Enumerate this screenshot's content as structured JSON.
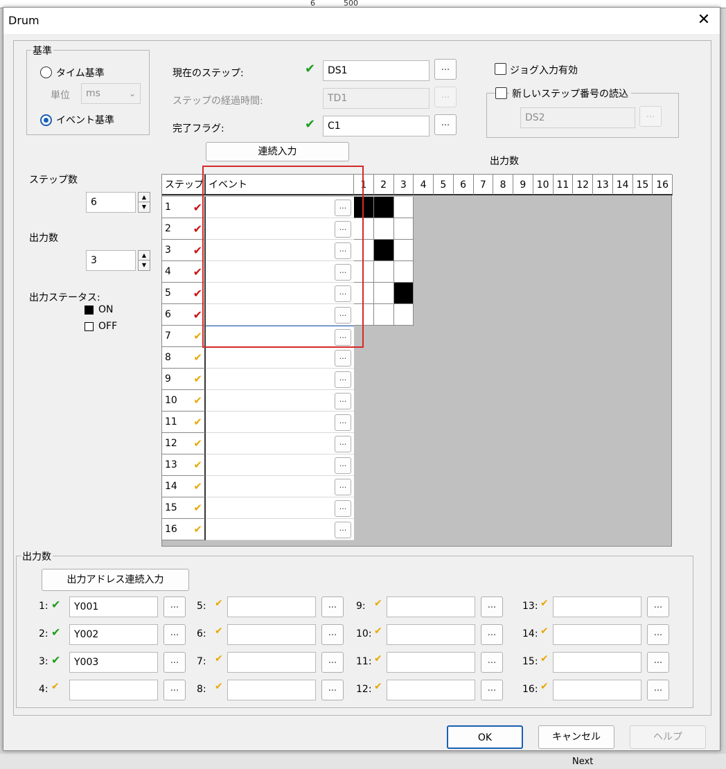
{
  "background": {
    "top_text_1": "6",
    "top_text_2": "500",
    "bottom_text": "Next"
  },
  "window": {
    "title": "Drum",
    "close_label": "✕"
  },
  "basis_group": {
    "legend": "基準",
    "time_basis_label": "タイム基準",
    "unit_label": "単位",
    "unit_value": "ms",
    "event_basis_label": "イベント基準",
    "selected": "event"
  },
  "steps_config": {
    "current_step_label": "現在のステップ:",
    "current_step_value": "DS1",
    "elapsed_label": "ステップの経過時間:",
    "elapsed_value": "TD1",
    "done_flag_label": "完了フラグ:",
    "done_flag_value": "C1",
    "dots": "..."
  },
  "jog": {
    "jog_label": "ジョグ入力有効",
    "new_step_label": "新しいステップ番号の読込",
    "new_step_value": "DS2"
  },
  "continuous_input_label": "連続入力",
  "left_panel": {
    "step_count_label": "ステップ数",
    "step_count_value": "6",
    "output_count_label": "出力数",
    "output_count_value": "3",
    "output_status_label": "出力ステータス:",
    "on_label": "ON",
    "off_label": "OFF"
  },
  "table": {
    "step_header": "ステップ",
    "event_header": "イベント",
    "outputs_header": "出力数",
    "output_numbers": [
      "1",
      "2",
      "3",
      "4",
      "5",
      "6",
      "7",
      "8",
      "9",
      "10",
      "11",
      "12",
      "13",
      "14",
      "15",
      "16"
    ],
    "steps": [
      {
        "num": "1",
        "status": "set"
      },
      {
        "num": "2",
        "status": "set"
      },
      {
        "num": "3",
        "status": "set"
      },
      {
        "num": "4",
        "status": "set"
      },
      {
        "num": "5",
        "status": "set"
      },
      {
        "num": "6",
        "status": "set"
      },
      {
        "num": "7",
        "status": "unset"
      },
      {
        "num": "8",
        "status": "unset"
      },
      {
        "num": "9",
        "status": "unset"
      },
      {
        "num": "10",
        "status": "unset"
      },
      {
        "num": "11",
        "status": "unset"
      },
      {
        "num": "12",
        "status": "unset"
      },
      {
        "num": "13",
        "status": "unset"
      },
      {
        "num": "14",
        "status": "unset"
      },
      {
        "num": "15",
        "status": "unset"
      },
      {
        "num": "16",
        "status": "unset"
      }
    ],
    "grid_on": [
      [
        1,
        1,
        0
      ],
      [
        0,
        0,
        0
      ],
      [
        0,
        1,
        0
      ],
      [
        0,
        0,
        0
      ],
      [
        0,
        0,
        1
      ],
      [
        0,
        0,
        0
      ]
    ]
  },
  "output_group": {
    "legend": "出力数",
    "continuous_button": "出力アドレス連続入力",
    "outputs": [
      {
        "label": "1:",
        "value": "Y001",
        "set": true
      },
      {
        "label": "2:",
        "value": "Y002",
        "set": true
      },
      {
        "label": "3:",
        "value": "Y003",
        "set": true
      },
      {
        "label": "4:",
        "value": "",
        "set": false
      },
      {
        "label": "5:",
        "value": "",
        "set": false
      },
      {
        "label": "6:",
        "value": "",
        "set": false
      },
      {
        "label": "7:",
        "value": "",
        "set": false
      },
      {
        "label": "8:",
        "value": "",
        "set": false
      },
      {
        "label": "9:",
        "value": "",
        "set": false
      },
      {
        "label": "10:",
        "value": "",
        "set": false
      },
      {
        "label": "11:",
        "value": "",
        "set": false
      },
      {
        "label": "12:",
        "value": "",
        "set": false
      },
      {
        "label": "13:",
        "value": "",
        "set": false
      },
      {
        "label": "14:",
        "value": "",
        "set": false
      },
      {
        "label": "15:",
        "value": "",
        "set": false
      },
      {
        "label": "16:",
        "value": "",
        "set": false
      }
    ]
  },
  "footer": {
    "ok": "OK",
    "cancel": "キャンセル",
    "help": "ヘルプ"
  },
  "colors": {
    "check_green": "#1e9e1e",
    "check_yellow": "#e8a800",
    "check_red": "#c81414",
    "highlight_red": "#d62828"
  }
}
